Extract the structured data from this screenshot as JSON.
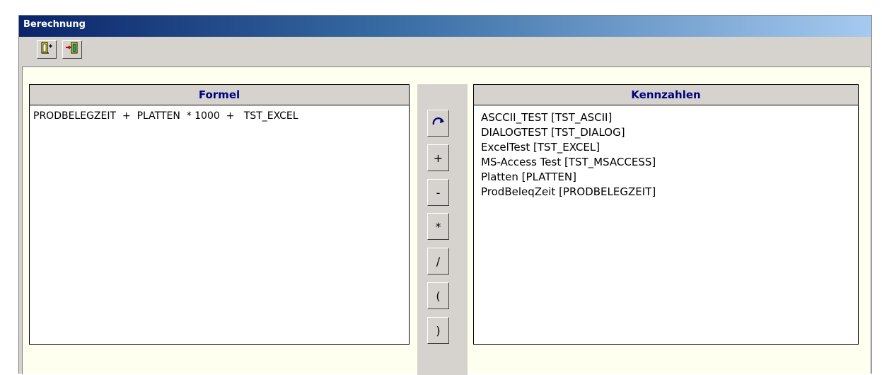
{
  "window": {
    "title": "Berechnung"
  },
  "toolbar": {
    "buttons": [
      {
        "icon": "door-enter-icon"
      },
      {
        "icon": "door-exit-icon"
      }
    ]
  },
  "formel": {
    "header": "Formel",
    "text": "PRODBELEGZEIT  +  PLATTEN  * 1000  +   TST_EXCEL"
  },
  "operators": [
    {
      "icon": "redo-arrow-icon"
    },
    {
      "label": "+"
    },
    {
      "label": "-"
    },
    {
      "label": "*"
    },
    {
      "label": "/"
    },
    {
      "label": "("
    },
    {
      "label": ")"
    }
  ],
  "kennzahlen": {
    "header": "Kennzahlen",
    "items": [
      "ASCCII_TEST [TST_ASCII]",
      "DIALOGTEST [TST_DIALOG]",
      "ExcelTest [TST_EXCEL]",
      "MS-Access Test [TST_MSACCESS]",
      "Platten [PLATTEN]",
      "ProdBeleqZeit [PRODBELEGZEIT]"
    ]
  }
}
